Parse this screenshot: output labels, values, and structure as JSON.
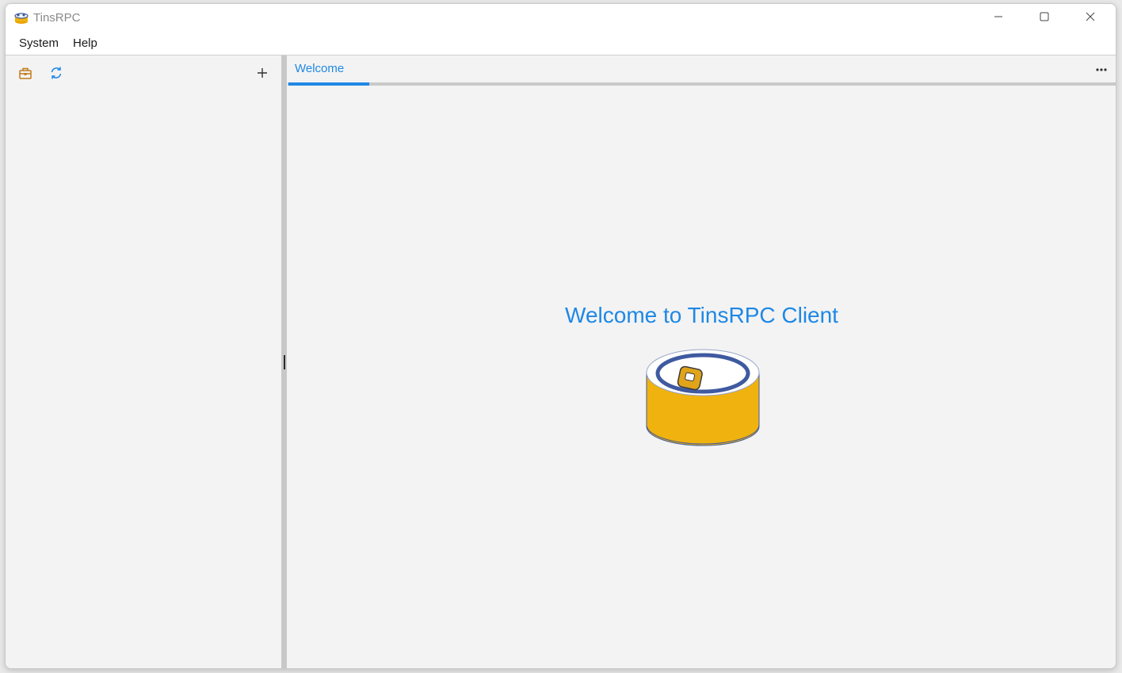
{
  "window": {
    "title": "TinsRPC",
    "app_icon": "tin-can-icon",
    "controls": [
      "minimize-icon",
      "maximize-icon",
      "close-icon"
    ]
  },
  "menubar": {
    "items": [
      {
        "label": "System"
      },
      {
        "label": "Help"
      }
    ]
  },
  "sidebar": {
    "toolbar": [
      {
        "icon": "toolbox-icon"
      },
      {
        "icon": "refresh-icon"
      },
      {
        "icon": "plus-icon",
        "label": "+"
      }
    ]
  },
  "tabs": [
    {
      "label": "Welcome",
      "active": true
    }
  ],
  "tab_more": {
    "label": "•••"
  },
  "main": {
    "welcome_title": "Welcome to TinsRPC Client",
    "logo": "tin-can-logo"
  },
  "colors": {
    "accent": "#1e88e5",
    "can_body": "#f0b20f",
    "can_ring": "#3f5aa0",
    "titlebar": "#ffffff",
    "background": "#f3f3f3"
  }
}
